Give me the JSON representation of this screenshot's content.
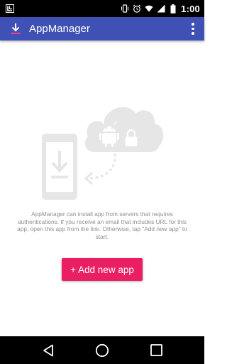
{
  "status_bar": {
    "time": "1:00",
    "icons": [
      "notification-app-icon",
      "vibrate-icon",
      "alarm-icon",
      "wifi-icon",
      "signal-icon",
      "battery-icon"
    ]
  },
  "app_bar": {
    "title": "AppManager",
    "background": "#3f51b5",
    "logo_icon": "download-icon",
    "menu_icon": "overflow-menu-icon"
  },
  "main": {
    "illustration_icons": [
      "phone-download-icon",
      "cloud-android-lock-icon",
      "dashed-arrow-icon"
    ],
    "description": "AppManager can install app from servers that requires authentications. If you receive an email that includes URL for this app, open this app from the link. Otherwise, tap \"Add new app\" to start.",
    "add_button_label": "+ Add new app",
    "accent": "#e91e63"
  },
  "nav_bar": {
    "buttons": [
      "back-icon",
      "home-icon",
      "recents-icon"
    ]
  }
}
